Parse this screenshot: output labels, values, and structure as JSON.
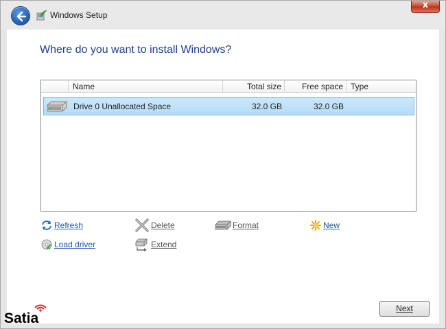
{
  "window": {
    "title": "Windows Setup",
    "close_glyph": "x",
    "icons": {
      "back": "back-arrow-icon",
      "setup": "windows-setup-icon",
      "close": "close-icon"
    }
  },
  "page": {
    "heading": "Where do you want to install Windows?"
  },
  "table": {
    "columns": {
      "name": "Name",
      "total": "Total size",
      "free": "Free space",
      "type": "Type"
    },
    "rows": [
      {
        "name": "Drive 0 Unallocated Space",
        "total": "32.0 GB",
        "free": "32.0 GB",
        "type": "",
        "icon": "hard-drive-icon",
        "selected": true
      }
    ]
  },
  "actions": {
    "refresh": {
      "label": "Refresh",
      "enabled": true,
      "icon": "refresh-icon"
    },
    "delete": {
      "label": "Delete",
      "enabled": false,
      "icon": "delete-icon"
    },
    "format": {
      "label": "Format",
      "enabled": false,
      "icon": "format-drive-icon"
    },
    "new": {
      "label": "New",
      "enabled": true,
      "icon": "new-partition-icon"
    },
    "load_driver": {
      "label": "Load driver",
      "enabled": true,
      "icon": "load-driver-icon"
    },
    "extend": {
      "label": "Extend",
      "enabled": false,
      "icon": "extend-icon"
    }
  },
  "buttons": {
    "next": "Next"
  },
  "watermark": {
    "logo_text": "Satia"
  },
  "colors": {
    "heading": "#1c3e8c",
    "link": "#1c56b0",
    "selection": "#cde8fb",
    "close": "#c7442a"
  }
}
